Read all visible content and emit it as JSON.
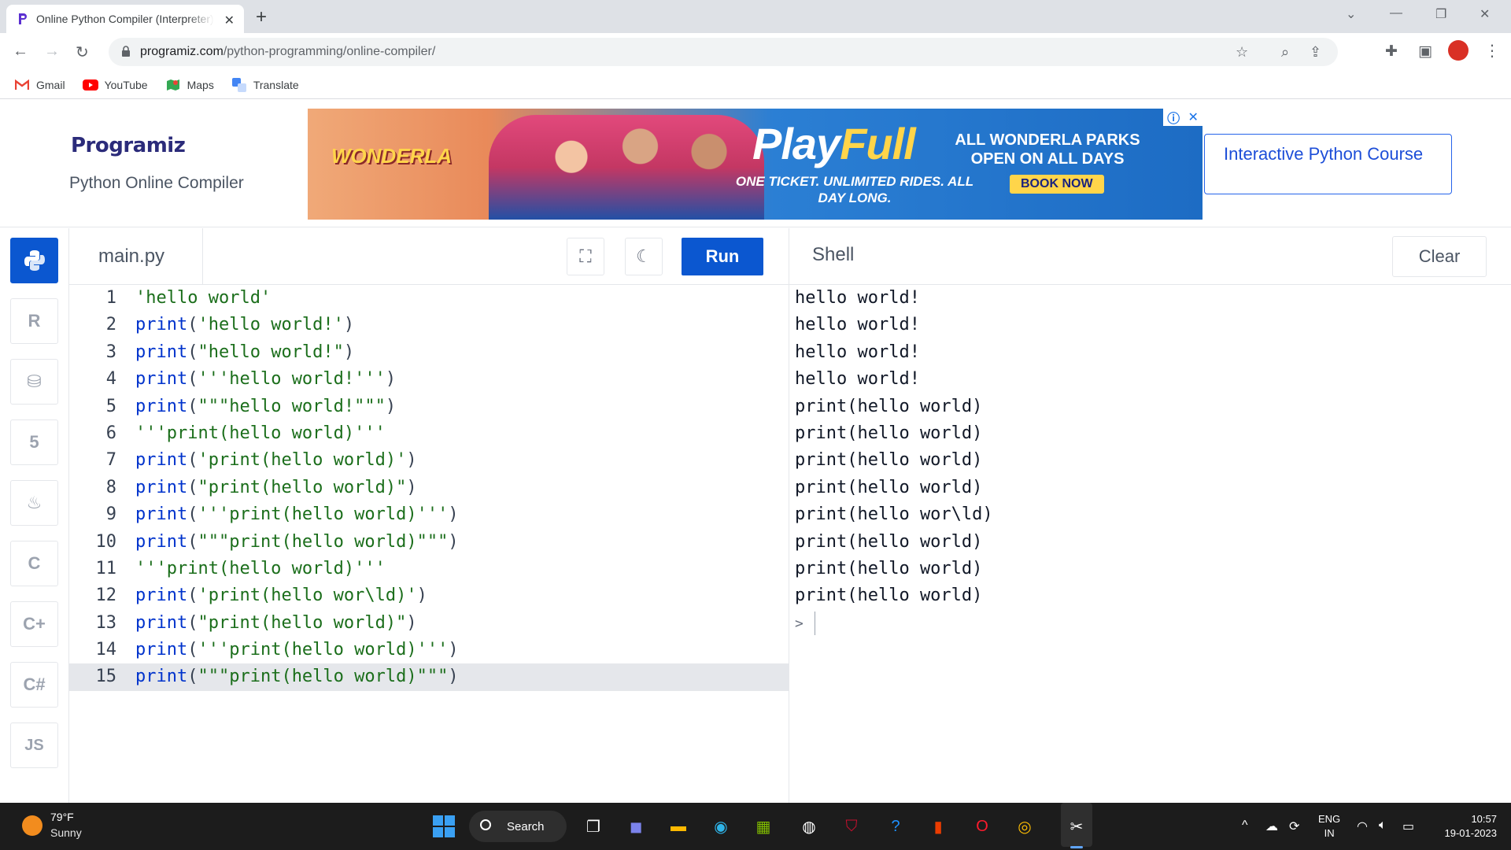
{
  "browser": {
    "tab_title": "Online Python Compiler (Interpreter)",
    "url_domain": "programiz.com",
    "url_path": "/python-programming/online-compiler/",
    "bookmarks": [
      "Gmail",
      "YouTube",
      "Maps",
      "Translate"
    ]
  },
  "header": {
    "logo": "Programiz",
    "subtitle": "Python Online Compiler",
    "ad": {
      "brand": "WONDERLA",
      "headline_a": "Play",
      "headline_b": "Full",
      "tagline": "ONE TICKET. UNLIMITED RIDES. ALL DAY LONG.",
      "open_text": "ALL WONDERLA PARKS OPEN ON ALL DAYS",
      "cta": "BOOK NOW"
    },
    "course_link": "Interactive Python Course"
  },
  "rail": {
    "items": [
      "python",
      "r",
      "sql",
      "html",
      "java",
      "c",
      "cpp",
      "csharp",
      "JS"
    ]
  },
  "editor": {
    "filename": "main.py",
    "run_label": "Run",
    "lines": [
      {
        "n": "1",
        "kw": "",
        "open": "",
        "str": "'hello world'",
        "close": ""
      },
      {
        "n": "2",
        "kw": "print",
        "open": "(",
        "str": "'hello world!'",
        "close": ")"
      },
      {
        "n": "3",
        "kw": "print",
        "open": "(",
        "str": "\"hello world!\"",
        "close": ")"
      },
      {
        "n": "4",
        "kw": "print",
        "open": "(",
        "str": "'''hello world!'''",
        "close": ")"
      },
      {
        "n": "5",
        "kw": "print",
        "open": "(",
        "str": "\"\"\"hello world!\"\"\"",
        "close": ")"
      },
      {
        "n": "6",
        "kw": "",
        "open": "",
        "str": "'''print(hello world)'''",
        "close": ""
      },
      {
        "n": "7",
        "kw": "print",
        "open": "(",
        "str": "'print(hello world)'",
        "close": ")"
      },
      {
        "n": "8",
        "kw": "print",
        "open": "(",
        "str": "\"print(hello world)\"",
        "close": ")"
      },
      {
        "n": "9",
        "kw": "print",
        "open": "(",
        "str": "'''print(hello world)'''",
        "close": ")"
      },
      {
        "n": "10",
        "kw": "print",
        "open": "(",
        "str": "\"\"\"print(hello world)\"\"\"",
        "close": ")"
      },
      {
        "n": "11",
        "kw": "",
        "open": "",
        "str": "'''print(hello world)'''",
        "close": ""
      },
      {
        "n": "12",
        "kw": "print",
        "open": "(",
        "str": "'print(hello wor\\ld)'",
        "close": ")"
      },
      {
        "n": "13",
        "kw": "print",
        "open": "(",
        "str": "\"print(hello world)\"",
        "close": ")"
      },
      {
        "n": "14",
        "kw": "print",
        "open": "(",
        "str": "'''print(hello world)'''",
        "close": ")"
      },
      {
        "n": "15",
        "kw": "print",
        "open": "(",
        "str": "\"\"\"print(hello world)\"\"\"",
        "close": ")"
      }
    ]
  },
  "shell": {
    "title": "Shell",
    "clear_label": "Clear",
    "output": [
      "hello world!",
      "hello world!",
      "hello world!",
      "hello world!",
      "print(hello world)",
      "print(hello world)",
      "print(hello world)",
      "print(hello world)",
      "print(hello wor\\ld)",
      "print(hello world)",
      "print(hello world)",
      "print(hello world)"
    ],
    "prompt": ">"
  },
  "taskbar": {
    "temp": "79°F",
    "weather": "Sunny",
    "search": "Search",
    "lang_a": "ENG",
    "lang_b": "IN",
    "time": "10:57",
    "date": "19-01-2023"
  }
}
